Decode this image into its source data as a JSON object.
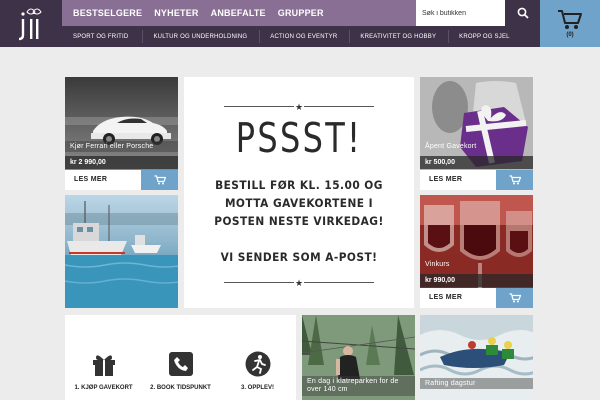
{
  "header": {
    "nav_top": [
      "BESTSELGERE",
      "NYHETER",
      "ANBEFALTE",
      "GRUPPER"
    ],
    "nav_sub": [
      "SPORT OG FRITID",
      "KULTUR OG UNDERHOLDNING",
      "ACTION OG EVENTYR",
      "KREATIVITET OG HOBBY",
      "KROPP OG SJEL"
    ],
    "search_placeholder": "Søk i butikken",
    "cart_count": "(0)",
    "colors": {
      "nav_purple": "#8a6f95",
      "dark_purple": "#3d3248",
      "accent_blue": "#6fa3c9"
    }
  },
  "cards": [
    {
      "caption": "Kjør Ferrari eller Porsche",
      "price": "kr 2 990,00",
      "more": "LES MER"
    },
    {
      "caption": "Åpent Gavekort",
      "price": "kr 500,00",
      "more": "LES MER"
    },
    {
      "caption": "Vinkurs",
      "price": "kr 990,00",
      "more": "LES MER"
    },
    {
      "caption": "En dag i klatreparken for de over 140 cm"
    },
    {
      "caption": "Rafting dagstur"
    }
  ],
  "promo": {
    "headline": "PSSST!",
    "line1": "BESTILL FØR KL. 15.00 OG",
    "line2": "MOTTA GAVEKORTENE I",
    "line3": "POSTEN NESTE VIRKEDAG!",
    "line4": "VI SENDER SOM A-POST!"
  },
  "steps": [
    {
      "label": "1. KJØP GAVEKORT",
      "icon": "gift-icon"
    },
    {
      "label": "2. BOOK TIDSPUNKT",
      "icon": "phone-icon"
    },
    {
      "label": "3. OPPLEV!",
      "icon": "runner-icon"
    }
  ]
}
